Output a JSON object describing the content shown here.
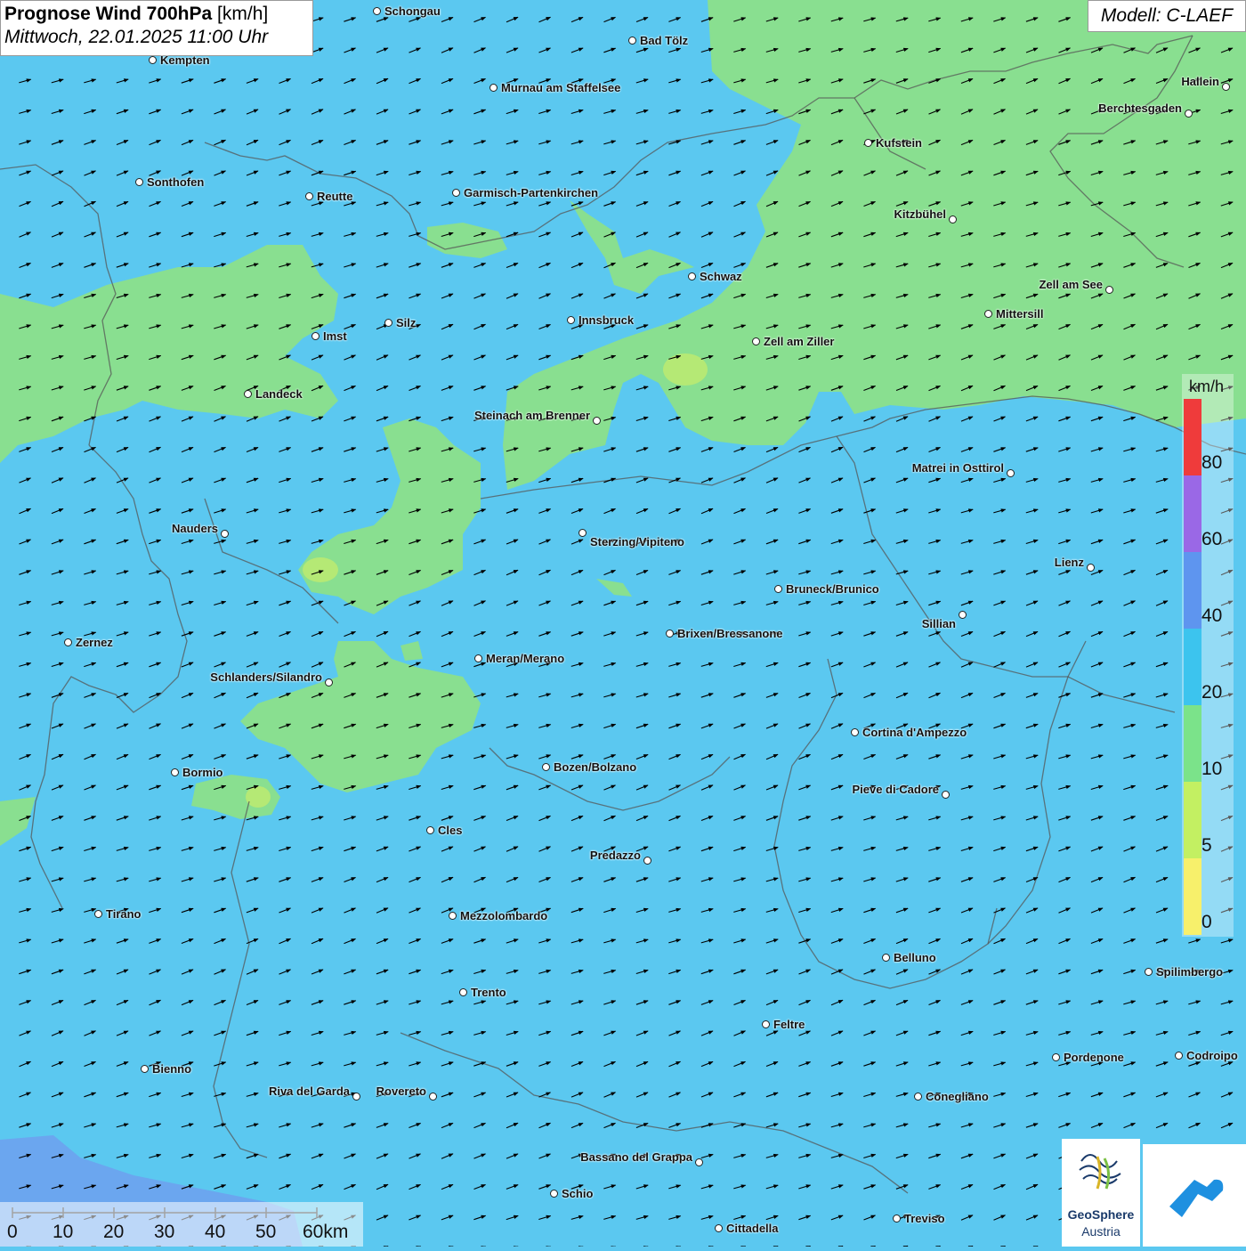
{
  "header": {
    "title_bold": "Prognose Wind 700hPa",
    "title_unit": "[km/h]",
    "date_line": "Mittwoch, 22.01.2025 11:00 Uhr",
    "model": "Modell: C-LAEF"
  },
  "legend": {
    "unit": "km/h",
    "labels": [
      "80",
      "60",
      "40",
      "20",
      "10",
      "5",
      "0"
    ],
    "colors": {
      "above80": "#ef3b3b",
      "60_80": "#9a68e6",
      "40_60": "#5e95ef",
      "20_40": "#3cc4ee",
      "10_20": "#7be38a",
      "5_10": "#c3f062",
      "0_5": "#f7f06b"
    }
  },
  "scalebar": {
    "labels": [
      "0",
      "10",
      "20",
      "30",
      "40",
      "50",
      "60km"
    ]
  },
  "wind": {
    "direction": "from west-southwest",
    "speed_band_main": "20-40 km/h",
    "speed_band_calm": "10-20 km/h"
  },
  "cities": [
    {
      "name": "Schongau"
    },
    {
      "name": "Bad Tölz"
    },
    {
      "name": "Kempten"
    },
    {
      "name": "Murnau am Staffelsee"
    },
    {
      "name": "Hallein"
    },
    {
      "name": "Berchtesgaden"
    },
    {
      "name": "Kufstein"
    },
    {
      "name": "Sonthofen"
    },
    {
      "name": "Reutte"
    },
    {
      "name": "Garmisch-Partenkirchen"
    },
    {
      "name": "Kitzbühel"
    },
    {
      "name": "Schwaz"
    },
    {
      "name": "Zell am See"
    },
    {
      "name": "Mittersill"
    },
    {
      "name": "Innsbruck"
    },
    {
      "name": "Silz"
    },
    {
      "name": "Imst"
    },
    {
      "name": "Zell am Ziller"
    },
    {
      "name": "Landeck"
    },
    {
      "name": "Steinach am Brenner"
    },
    {
      "name": "Matrei in Osttirol"
    },
    {
      "name": "Nauders"
    },
    {
      "name": "Sterzing/Vipiteno"
    },
    {
      "name": "Lienz"
    },
    {
      "name": "Bruneck/Brunico"
    },
    {
      "name": "Sillian"
    },
    {
      "name": "Brixen/Bressanone"
    },
    {
      "name": "Zernez"
    },
    {
      "name": "Meran/Merano"
    },
    {
      "name": "Schlanders/Silandro"
    },
    {
      "name": "Cortina d'Ampezzo"
    },
    {
      "name": "Bozen/Bolzano"
    },
    {
      "name": "Bormio"
    },
    {
      "name": "Pieve di Cadore"
    },
    {
      "name": "Cles"
    },
    {
      "name": "Predazzo"
    },
    {
      "name": "Tirano"
    },
    {
      "name": "Mezzolombardo"
    },
    {
      "name": "Belluno"
    },
    {
      "name": "Spilimbergo"
    },
    {
      "name": "Trento"
    },
    {
      "name": "Feltre"
    },
    {
      "name": "Pordenone"
    },
    {
      "name": "Codroipo"
    },
    {
      "name": "Bienno"
    },
    {
      "name": "Riva del Garda"
    },
    {
      "name": "Rovereto"
    },
    {
      "name": "Conegliano"
    },
    {
      "name": "Bassano del Grappa"
    },
    {
      "name": "Schio"
    },
    {
      "name": "Treviso"
    },
    {
      "name": "Cittadella"
    }
  ],
  "logos": {
    "geosphere_line1": "GeoSphere",
    "geosphere_line2": "Austria"
  }
}
